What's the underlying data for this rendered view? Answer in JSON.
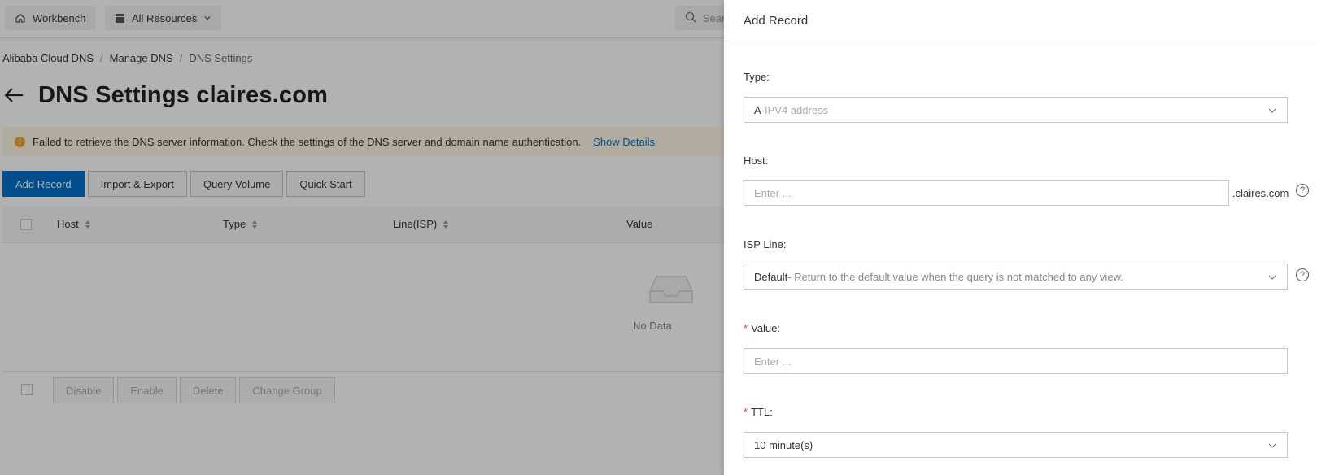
{
  "topbar": {
    "workbench_label": "Workbench",
    "all_resources_label": "All Resources",
    "search_placeholder": "Search..."
  },
  "breadcrumb": {
    "items": [
      "Alibaba Cloud DNS",
      "Manage DNS",
      "DNS Settings"
    ],
    "separator": "/"
  },
  "page": {
    "title": "DNS Settings claires.com"
  },
  "alert": {
    "message": "Failed to retrieve the DNS server information. Check the settings of the DNS server and domain name authentication.",
    "link": "Show Details",
    "icon": "warning-icon",
    "color": "#f5a623"
  },
  "actions": {
    "add_record": "Add Record",
    "import_export": "Import & Export",
    "query_volume": "Query Volume",
    "quick_start": "Quick Start"
  },
  "table": {
    "columns": [
      "Host",
      "Type",
      "Line(ISP)",
      "Value"
    ],
    "empty_text": "No Data"
  },
  "bulk_actions": {
    "disable": "Disable",
    "enable": "Enable",
    "delete": "Delete",
    "change_group": "Change Group"
  },
  "drawer": {
    "title": "Add Record",
    "type": {
      "label": "Type",
      "value_prefix": "A-",
      "value_text": " IPV4 address"
    },
    "host": {
      "label": "Host",
      "placeholder": "Enter ...",
      "suffix": ".claires.com"
    },
    "isp_line": {
      "label": "ISP Line",
      "value_main": "Default",
      "value_desc": " - Return to the default value when the query is not matched to any view."
    },
    "value": {
      "label": "Value",
      "placeholder": "Enter ..."
    },
    "ttl": {
      "label": "TTL",
      "value": "10 minute(s)"
    },
    "label_colon": ":",
    "required_mark": "*"
  },
  "colors": {
    "primary": "#0070cc",
    "required": "#f04134",
    "alert_bg": "#fff7e6"
  }
}
